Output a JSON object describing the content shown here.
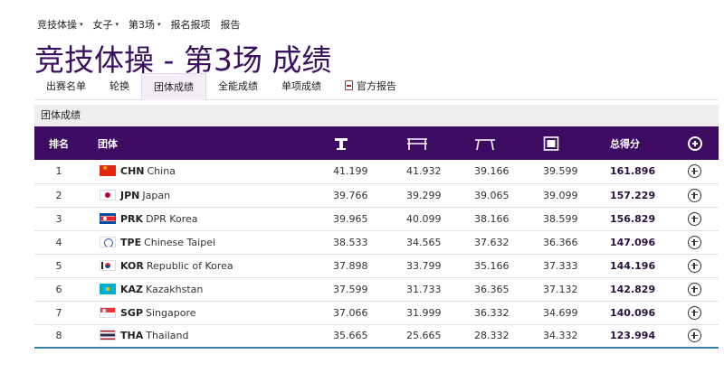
{
  "topnav": [
    {
      "label": "竞技体操",
      "dropdown": true
    },
    {
      "label": "女子",
      "dropdown": true
    },
    {
      "label": "第3场",
      "dropdown": true
    },
    {
      "label": "报名报项",
      "dropdown": false
    },
    {
      "label": "报告",
      "dropdown": false
    }
  ],
  "page_title": "竞技体操 - 第3场 成绩",
  "tabs": [
    {
      "label": "出赛名单",
      "active": false
    },
    {
      "label": "轮换",
      "active": false
    },
    {
      "label": "团体成绩",
      "active": true
    },
    {
      "label": "全能成绩",
      "active": false
    },
    {
      "label": "单项成绩",
      "active": false
    },
    {
      "label": "官方报告",
      "active": false,
      "icon": "pdf-icon"
    }
  ],
  "section_title": "团体成绩",
  "table": {
    "headers": {
      "rank": "排名",
      "team": "团体",
      "total": "总得分"
    },
    "apparatus_icons": [
      "vault-icon",
      "uneven-bars-icon",
      "balance-beam-icon",
      "floor-exercise-icon"
    ],
    "rows": [
      {
        "rank": "1",
        "flag": "chn",
        "code": "CHN",
        "name": "China",
        "v1": "41.199",
        "v2": "41.932",
        "v3": "39.166",
        "v4": "39.599",
        "total": "161.896"
      },
      {
        "rank": "2",
        "flag": "jpn",
        "code": "JPN",
        "name": "Japan",
        "v1": "39.766",
        "v2": "39.299",
        "v3": "39.065",
        "v4": "39.099",
        "total": "157.229"
      },
      {
        "rank": "3",
        "flag": "prk",
        "code": "PRK",
        "name": "DPR Korea",
        "v1": "39.965",
        "v2": "40.099",
        "v3": "38.166",
        "v4": "38.599",
        "total": "156.829"
      },
      {
        "rank": "4",
        "flag": "tpe",
        "code": "TPE",
        "name": "Chinese Taipei",
        "v1": "38.533",
        "v2": "34.565",
        "v3": "37.632",
        "v4": "36.366",
        "total": "147.096"
      },
      {
        "rank": "5",
        "flag": "kor",
        "code": "KOR",
        "name": "Republic of Korea",
        "v1": "37.898",
        "v2": "33.799",
        "v3": "35.166",
        "v4": "37.333",
        "total": "144.196"
      },
      {
        "rank": "6",
        "flag": "kaz",
        "code": "KAZ",
        "name": "Kazakhstan",
        "v1": "37.599",
        "v2": "31.733",
        "v3": "36.365",
        "v4": "37.132",
        "total": "142.829"
      },
      {
        "rank": "7",
        "flag": "sgp",
        "code": "SGP",
        "name": "Singapore",
        "v1": "37.066",
        "v2": "31.999",
        "v3": "36.332",
        "v4": "34.699",
        "total": "140.096"
      },
      {
        "rank": "8",
        "flag": "tha",
        "code": "THA",
        "name": "Thailand",
        "v1": "35.665",
        "v2": "25.665",
        "v3": "28.332",
        "v4": "34.332",
        "total": "123.994"
      }
    ]
  },
  "colors": {
    "title": "#3b1060",
    "header_bg": "#3d0c62",
    "active_tab_bg": "#f4eef7"
  }
}
